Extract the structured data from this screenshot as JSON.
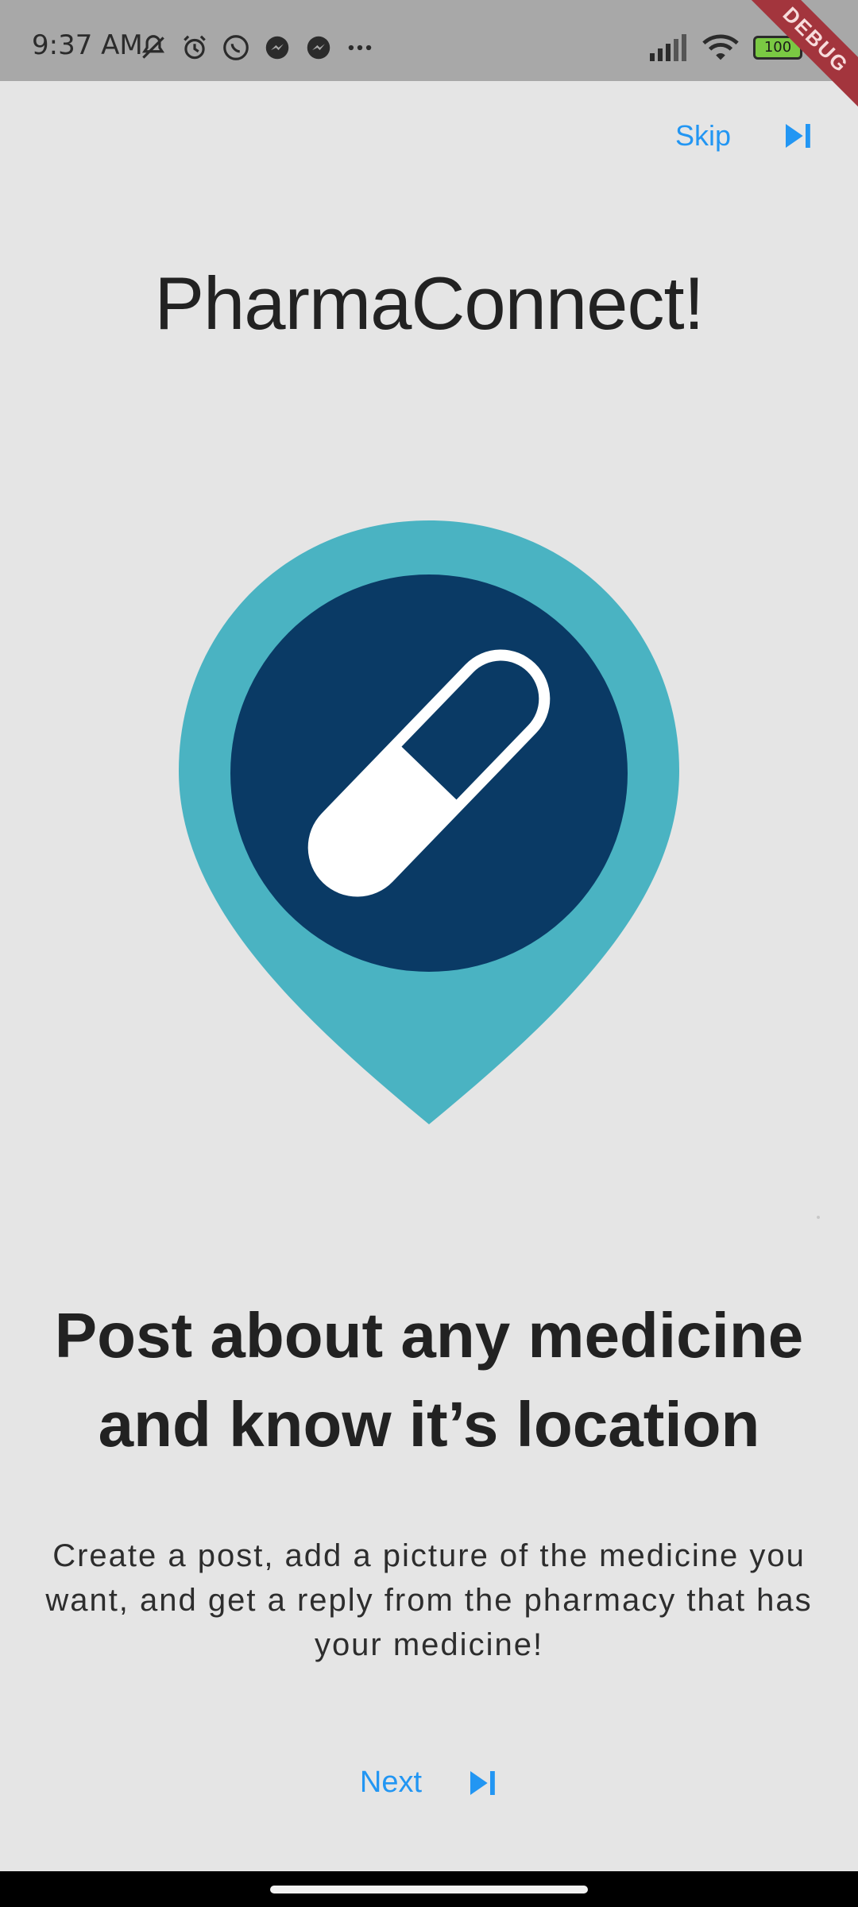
{
  "status_bar": {
    "time": "9:37 AM",
    "battery_level": "100",
    "left_icons": [
      "mute-icon",
      "alarm-icon",
      "whatsapp-icon",
      "messenger-icon",
      "messenger-icon",
      "more-icon"
    ],
    "right_icons": [
      "signal-icon",
      "wifi-icon",
      "battery-icon"
    ],
    "debug_banner": "DEBUG"
  },
  "header": {
    "skip_label": "Skip",
    "skip_icon": "skip-next-icon",
    "app_title": "PharmaConnect!"
  },
  "illustration": {
    "icon": "pill-location-pin-icon",
    "colors": {
      "pin": "#4ab3c2",
      "circle": "#0a3a65",
      "pill": "#ffffff"
    }
  },
  "content": {
    "headline": "Post about any medicine and know it’s location",
    "description": "Create a post, add a picture of the medicine you want, and get a reply from the pharmacy that has your medicine!"
  },
  "footer": {
    "next_label": "Next",
    "next_icon": "skip-next-icon"
  },
  "colors": {
    "accent": "#2296f3",
    "background": "#e5e5e5",
    "status_bar": "#a8a8a8"
  }
}
